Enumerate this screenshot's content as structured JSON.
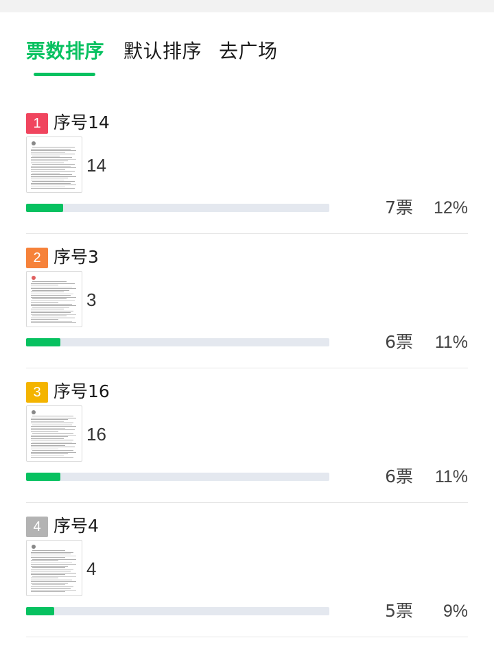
{
  "tabs": [
    {
      "label": "票数排序",
      "active": true
    },
    {
      "label": "默认排序",
      "active": false
    },
    {
      "label": "去广场",
      "active": false
    }
  ],
  "accent_color": "#07c160",
  "items": [
    {
      "rank": "1",
      "badge_color": "#f0455e",
      "title": "序号14",
      "caption": "14",
      "votes": "7票",
      "percent": "12%",
      "share": 0.12
    },
    {
      "rank": "2",
      "badge_color": "#f6823a",
      "title": "序号3",
      "caption": "3",
      "votes": "6票",
      "percent": "11%",
      "share": 0.11
    },
    {
      "rank": "3",
      "badge_color": "#f4b400",
      "title": "序号16",
      "caption": "16",
      "votes": "6票",
      "percent": "11%",
      "share": 0.11
    },
    {
      "rank": "4",
      "badge_color": "#b3b3b3",
      "title": "序号4",
      "caption": "4",
      "votes": "5票",
      "percent": "9%",
      "share": 0.09
    }
  ]
}
